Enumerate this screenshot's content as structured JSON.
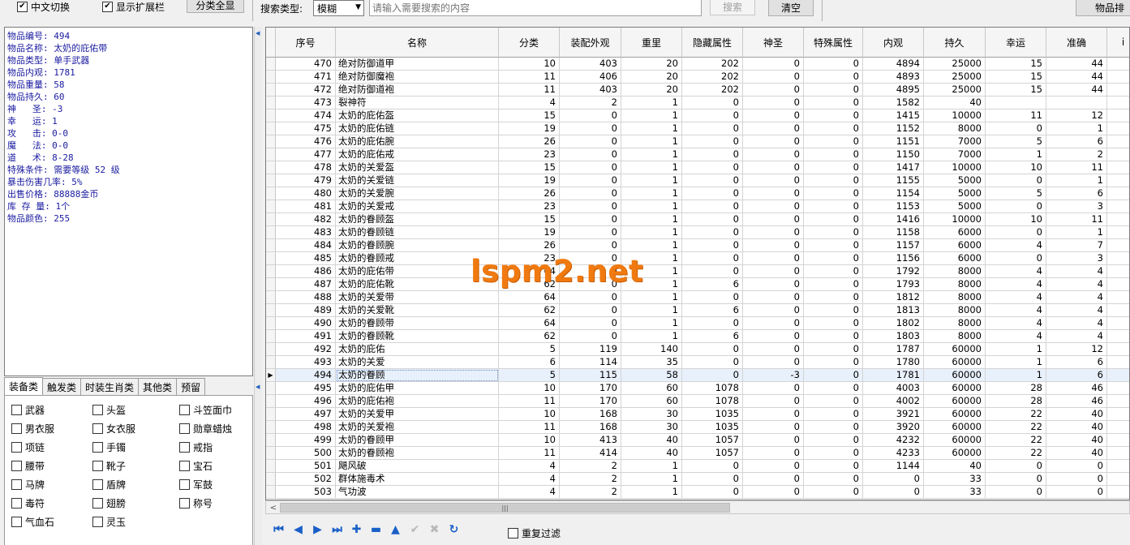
{
  "toolbar": {
    "chinese_switch": "中文切换",
    "show_ext_bar": "显示扩展栏",
    "select_all": "分类全显",
    "search_type_label": "搜索类型:",
    "search_type_value": "模糊",
    "search_placeholder": "请输入需要搜索的内容",
    "search_button": "搜索",
    "clear_button": "清空",
    "right_button": "物品排"
  },
  "info": [
    "物品编号: 494",
    "物品名称: 太奶的庇佑带",
    "物品类型: 单手武器",
    "物品内观: 1781",
    "物品重量: 58",
    "物品持久: 60",
    "神   圣: -3",
    "幸   运: 1",
    "攻   击: 0-0",
    "魔   法: 0-0",
    "道   术: 8-28",
    "特殊条件: 需要等级 52 级",
    "暴击伤害几率: 5%",
    "出售价格: 88888金币",
    "库 存 量: 1个",
    "物品颜色: 255"
  ],
  "tabs": [
    "装备类",
    "触发类",
    "时装生肖类",
    "其他类",
    "预留"
  ],
  "categories": [
    "武器",
    "头盔",
    "斗笠面巾",
    "男衣服",
    "女衣服",
    "勋章蜡烛",
    "项链",
    "手镯",
    "戒指",
    "腰带",
    "靴子",
    "宝石",
    "马牌",
    "盾牌",
    "军鼓",
    "毒符",
    "翅膀",
    "称号",
    "气血石",
    "灵玉"
  ],
  "columns": [
    "序号",
    "名称",
    "分类",
    "装配外观",
    "重里",
    "隐藏属性",
    "神圣",
    "特殊属性",
    "内观",
    "持久",
    "幸运",
    "准确",
    "i"
  ],
  "rows": [
    [
      "470",
      "绝对防御道甲",
      "10",
      "403",
      "20",
      "202",
      "0",
      "0",
      "4894",
      "25000",
      "15",
      "44"
    ],
    [
      "471",
      "绝对防御魔袍",
      "11",
      "406",
      "20",
      "202",
      "0",
      "0",
      "4893",
      "25000",
      "15",
      "44"
    ],
    [
      "472",
      "绝对防御道袍",
      "11",
      "403",
      "20",
      "202",
      "0",
      "0",
      "4895",
      "25000",
      "15",
      "44"
    ],
    [
      "473",
      "裂神符",
      "4",
      "2",
      "1",
      "0",
      "0",
      "0",
      "1582",
      "40",
      "",
      ""
    ],
    [
      "474",
      "太奶的庇佑盔",
      "15",
      "0",
      "1",
      "0",
      "0",
      "0",
      "1415",
      "10000",
      "11",
      "12"
    ],
    [
      "475",
      "太奶的庇佑链",
      "19",
      "0",
      "1",
      "0",
      "0",
      "0",
      "1152",
      "8000",
      "0",
      "1"
    ],
    [
      "476",
      "太奶的庇佑腕",
      "26",
      "0",
      "1",
      "0",
      "0",
      "0",
      "1151",
      "7000",
      "5",
      "6"
    ],
    [
      "477",
      "太奶的庇佑戒",
      "23",
      "0",
      "1",
      "0",
      "0",
      "0",
      "1150",
      "7000",
      "1",
      "2"
    ],
    [
      "478",
      "太奶的关爱盔",
      "15",
      "0",
      "1",
      "0",
      "0",
      "0",
      "1417",
      "10000",
      "10",
      "11"
    ],
    [
      "479",
      "太奶的关爱链",
      "19",
      "0",
      "1",
      "0",
      "0",
      "0",
      "1155",
      "5000",
      "0",
      "1"
    ],
    [
      "480",
      "太奶的关爱腕",
      "26",
      "0",
      "1",
      "0",
      "0",
      "0",
      "1154",
      "5000",
      "5",
      "6"
    ],
    [
      "481",
      "太奶的关爱戒",
      "23",
      "0",
      "1",
      "0",
      "0",
      "0",
      "1153",
      "5000",
      "0",
      "3"
    ],
    [
      "482",
      "太奶的眷顾盔",
      "15",
      "0",
      "1",
      "0",
      "0",
      "0",
      "1416",
      "10000",
      "10",
      "11"
    ],
    [
      "483",
      "太奶的眷顾链",
      "19",
      "0",
      "1",
      "0",
      "0",
      "0",
      "1158",
      "6000",
      "0",
      "1"
    ],
    [
      "484",
      "太奶的眷顾腕",
      "26",
      "0",
      "1",
      "0",
      "0",
      "0",
      "1157",
      "6000",
      "4",
      "7"
    ],
    [
      "485",
      "太奶的眷顾戒",
      "23",
      "0",
      "1",
      "0",
      "0",
      "0",
      "1156",
      "6000",
      "0",
      "3"
    ],
    [
      "486",
      "太奶的庇佑带",
      "64",
      "0",
      "1",
      "0",
      "0",
      "0",
      "1792",
      "8000",
      "4",
      "4"
    ],
    [
      "487",
      "太奶的庇佑靴",
      "62",
      "0",
      "1",
      "6",
      "0",
      "0",
      "1793",
      "8000",
      "4",
      "4"
    ],
    [
      "488",
      "太奶的关爱带",
      "64",
      "0",
      "1",
      "0",
      "0",
      "0",
      "1812",
      "8000",
      "4",
      "4"
    ],
    [
      "489",
      "太奶的关爱靴",
      "62",
      "0",
      "1",
      "6",
      "0",
      "0",
      "1813",
      "8000",
      "4",
      "4"
    ],
    [
      "490",
      "太奶的眷顾带",
      "64",
      "0",
      "1",
      "0",
      "0",
      "0",
      "1802",
      "8000",
      "4",
      "4"
    ],
    [
      "491",
      "太奶的眷顾靴",
      "62",
      "0",
      "1",
      "6",
      "0",
      "0",
      "1803",
      "8000",
      "4",
      "4"
    ],
    [
      "492",
      "太奶的庇佑",
      "5",
      "119",
      "140",
      "0",
      "0",
      "0",
      "1787",
      "60000",
      "1",
      "12"
    ],
    [
      "493",
      "太奶的关爱",
      "6",
      "114",
      "35",
      "0",
      "0",
      "0",
      "1780",
      "60000",
      "1",
      "6"
    ],
    [
      "494",
      "太奶的眷顾",
      "5",
      "115",
      "58",
      "0",
      "-3",
      "0",
      "1781",
      "60000",
      "1",
      "6"
    ],
    [
      "495",
      "太奶的庇佑甲",
      "10",
      "170",
      "60",
      "1078",
      "0",
      "0",
      "4003",
      "60000",
      "28",
      "46"
    ],
    [
      "496",
      "太奶的庇佑袍",
      "11",
      "170",
      "60",
      "1078",
      "0",
      "0",
      "4002",
      "60000",
      "28",
      "46"
    ],
    [
      "497",
      "太奶的关爱甲",
      "10",
      "168",
      "30",
      "1035",
      "0",
      "0",
      "3921",
      "60000",
      "22",
      "40"
    ],
    [
      "498",
      "太奶的关爱袍",
      "11",
      "168",
      "30",
      "1035",
      "0",
      "0",
      "3920",
      "60000",
      "22",
      "40"
    ],
    [
      "499",
      "太奶的眷顾甲",
      "10",
      "413",
      "40",
      "1057",
      "0",
      "0",
      "4232",
      "60000",
      "22",
      "40"
    ],
    [
      "500",
      "太奶的眷顾袍",
      "11",
      "414",
      "40",
      "1057",
      "0",
      "0",
      "4233",
      "60000",
      "22",
      "40"
    ],
    [
      "501",
      "飓风破",
      "4",
      "2",
      "1",
      "0",
      "0",
      "0",
      "1144",
      "40",
      "0",
      "0"
    ],
    [
      "502",
      "群体施毒术",
      "4",
      "2",
      "1",
      "0",
      "0",
      "0",
      "0",
      "33",
      "0",
      "0"
    ],
    [
      "503",
      "气功波",
      "4",
      "2",
      "1",
      "0",
      "0",
      "0",
      "0",
      "33",
      "0",
      "0"
    ]
  ],
  "selected_row": "494",
  "repeat_filter": "重复过滤",
  "watermark": "lspm2.net"
}
